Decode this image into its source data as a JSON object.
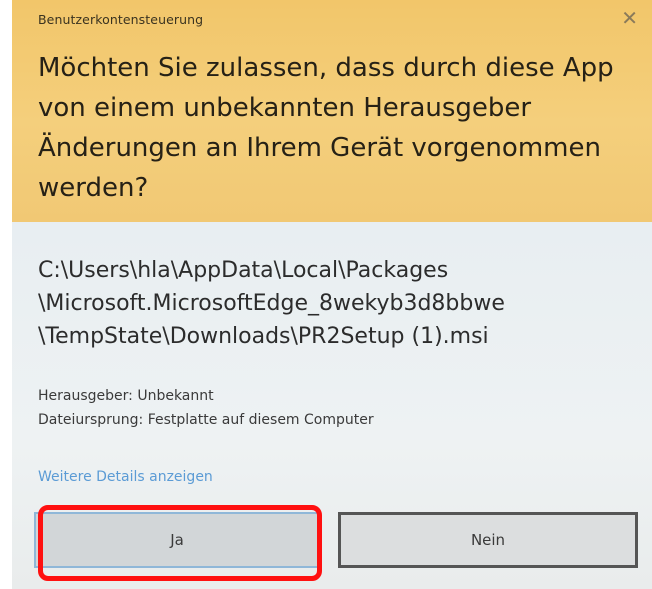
{
  "dialog": {
    "title": "Benutzerkontensteuerung",
    "close_icon": "close-icon",
    "question": "Möchten Sie zulassen, dass durch diese App\nvon einem unbekannten Herausgeber\nÄnderungen an Ihrem Gerät vorgenommen\nwerden?",
    "path": "C:\\Users\\hla\\AppData\\Local\\Packages\n\\Microsoft.MicrosoftEdge_8wekyb3d8bbwe\n\\TempState\\Downloads\\PR2Setup (1).msi",
    "publisher": "Herausgeber: Unbekannt",
    "origin": "Dateiursprung: Festplatte auf diesem Computer",
    "details_link": "Weitere Details anzeigen",
    "yes_label": "Ja",
    "no_label": "Nein"
  },
  "colors": {
    "header": "#f2c66a",
    "body": "#eef1f2",
    "link": "#5b9bd5",
    "highlight": "#ff1010"
  }
}
